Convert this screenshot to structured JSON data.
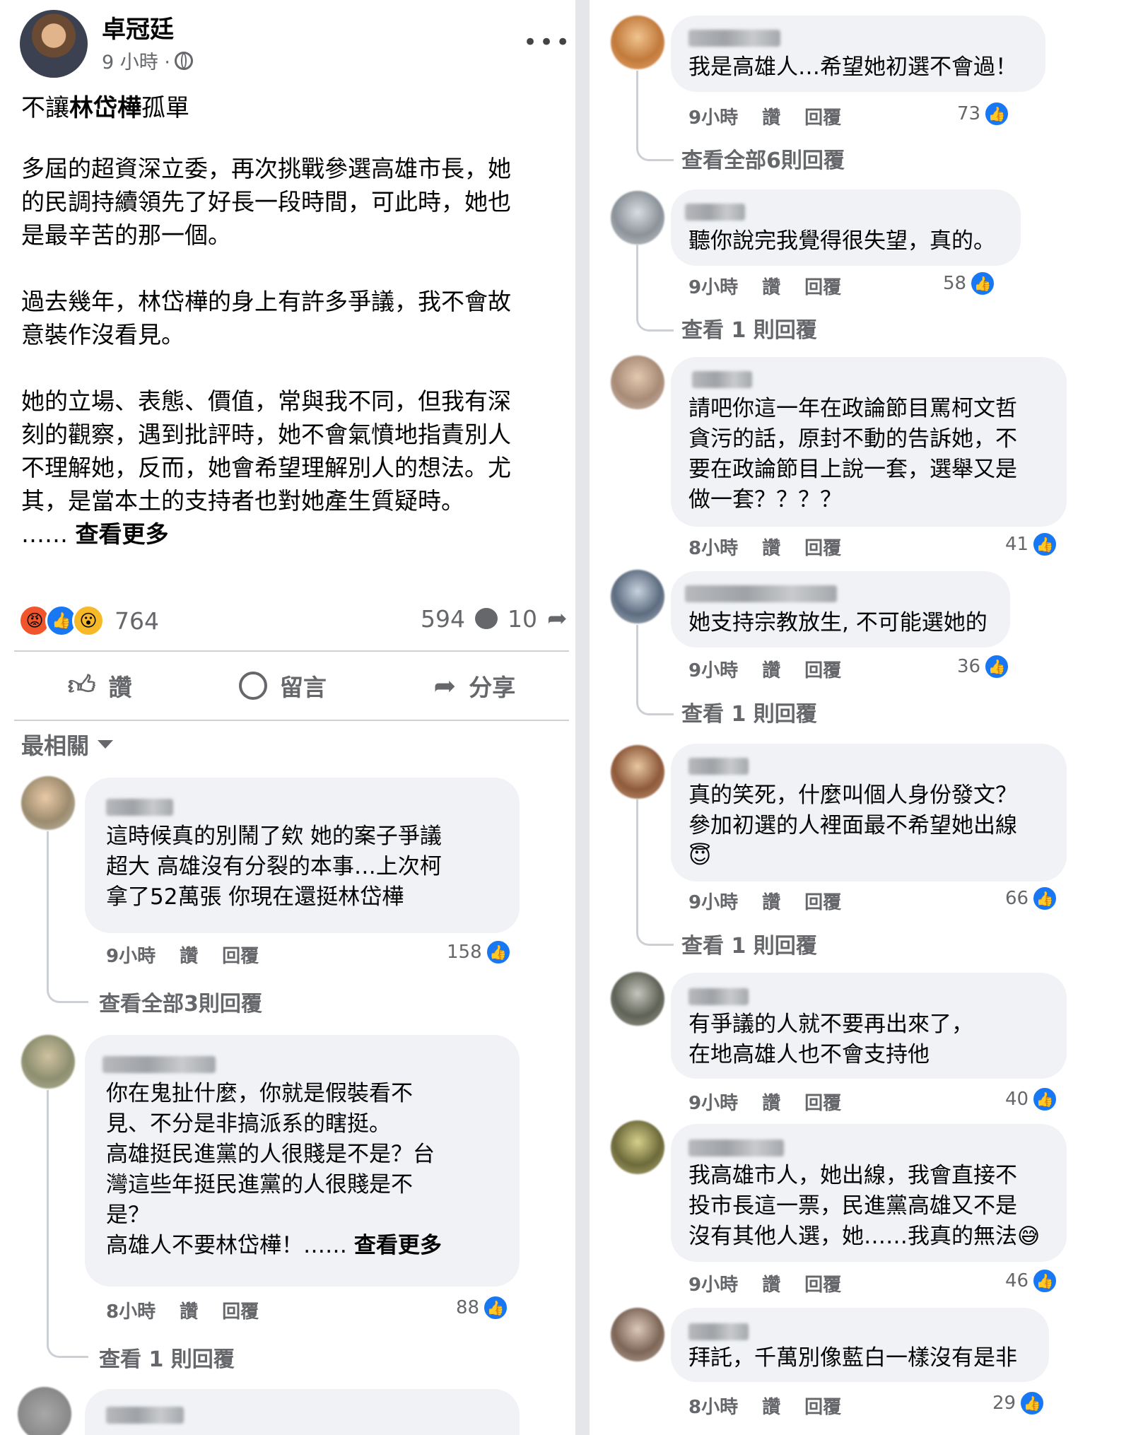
{
  "post": {
    "author": "卓冠廷",
    "time": "9 小時 · ",
    "headline_pre": "不讓",
    "headline_bold": "林岱樺",
    "headline_post": "孤單",
    "body": "多屆的超資深立委，再次挑戰參選高雄市長，她\n的民調持續領先了好長一段時間，可此時，她也\n是最辛苦的那一個。\n\n過去幾年，林岱樺的身上有許多爭議，我不會故\n意裝作沒看見。\n\n她的立場、表態、價值，常與我不同，但我有深\n刻的觀察，遇到批評時，她不會氣憤地指責別人\n不理解她，反而，她會希望理解別人的想法。尤\n其，是當本土的支持者也對她產生質疑時。\n",
    "ellipsis": "……",
    "see_more": "查看更多",
    "reaction_count": "764",
    "comment_count": "594",
    "share_count": "10",
    "actions": {
      "like": "讚",
      "comment": "留言",
      "share": "分享"
    },
    "sort_label": "最相關"
  },
  "icons": {
    "more": "more-options-icon",
    "globe": "globe-icon",
    "like": "thumbs-up-icon",
    "comment": "comment-bubble-icon",
    "share": "share-arrow-icon",
    "reactions": [
      "angry-reaction-icon",
      "like-reaction-icon",
      "wow-reaction-icon"
    ]
  },
  "comments_left": [
    {
      "text": "這時候真的別鬧了欸 她的案子爭議\n超大 高雄沒有分裂的本事…上次柯\n拿了52萬張 你現在還挺林岱樺",
      "time": "9小時",
      "like": "讚",
      "reply": "回覆",
      "likes": "158",
      "view_replies": "查看全部3則回覆"
    },
    {
      "text": "你在鬼扯什麼，你就是假裝看不\n見、不分是非搞派系的瞎挺。\n高雄挺民進黨的人很賤是不是？台\n灣這些年挺民進黨的人很賤是不\n是？\n高雄人不要林岱樺！…… ",
      "see_more": "查看更多",
      "time": "8小時",
      "like": "讚",
      "reply": "回覆",
      "likes": "88",
      "view_replies": "查看 1 則回覆"
    }
  ],
  "comments_right": [
    {
      "text": "我是高雄人…希望她初選不會過！",
      "time": "9小時",
      "like": "讚",
      "reply": "回覆",
      "likes": "73",
      "view_replies": "查看全部6則回覆"
    },
    {
      "text": "聽你說完我覺得很失望，真的。",
      "time": "9小時",
      "like": "讚",
      "reply": "回覆",
      "likes": "58",
      "view_replies": "查看 1 則回覆"
    },
    {
      "text": "請吧你這一年在政論節目罵柯文哲\n貪污的話，原封不動的告訴她，不\n要在政論節目上說一套，選舉又是\n做一套？？？？",
      "time": "8小時",
      "like": "讚",
      "reply": "回覆",
      "likes": "41"
    },
    {
      "text": "她支持宗教放生, 不可能選她的",
      "time": "9小時",
      "like": "讚",
      "reply": "回覆",
      "likes": "36",
      "view_replies": "查看 1 則回覆"
    },
    {
      "text": "真的笑死，什麼叫個人身份發文？\n參加初選的人裡面最不希望她出線\n😇",
      "time": "9小時",
      "like": "讚",
      "reply": "回覆",
      "likes": "66",
      "view_replies": "查看 1 則回覆"
    },
    {
      "text": "有爭議的人就不要再出來了，\n在地高雄人也不會支持他",
      "time": "9小時",
      "like": "讚",
      "reply": "回覆",
      "likes": "40"
    },
    {
      "text": "我高雄市人，她出線，我會直接不\n投市長這一票，民進黨高雄又不是\n沒有其他人選，她……我真的無法😅",
      "time": "9小時",
      "like": "讚",
      "reply": "回覆",
      "likes": "46"
    },
    {
      "text": "拜託，千萬別像藍白一樣沒有是非",
      "time": "8小時",
      "like": "讚",
      "reply": "回覆",
      "likes": "29"
    }
  ],
  "colors": {
    "like_blue": "#1877f2",
    "bubble_bg": "#f0f2f5",
    "meta_gray": "#65676b"
  }
}
